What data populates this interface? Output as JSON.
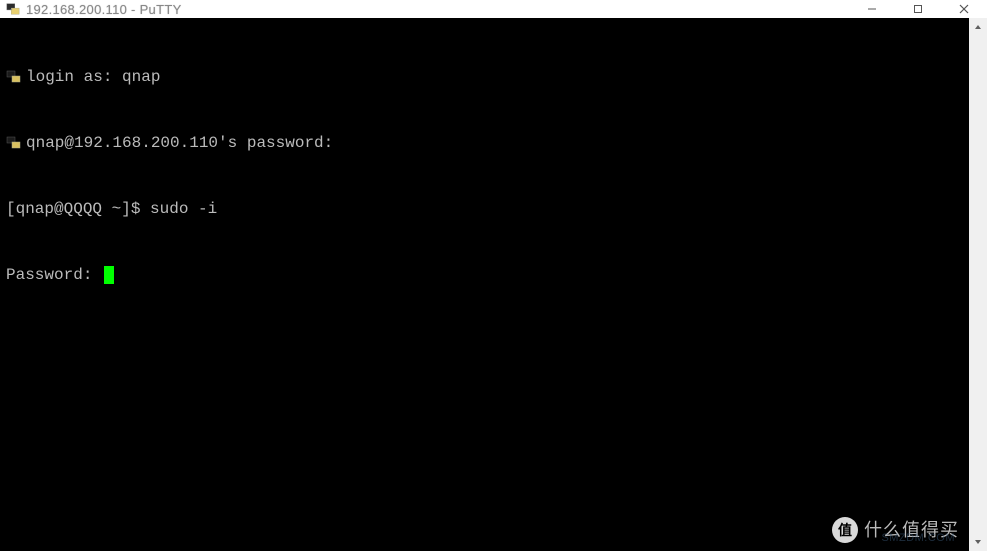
{
  "window": {
    "title": "192.168.200.110 - PuTTY"
  },
  "terminal": {
    "line1_prefix": "login as: ",
    "line1_value": "qnap",
    "line2": "qnap@192.168.200.110's password:",
    "line3_prompt": "[qnap@QQQQ ~]$ ",
    "line3_cmd": "sudo -i",
    "line4": "Password: "
  },
  "watermark": {
    "badge": "值",
    "text": "什么值得买",
    "sub": "SMZDM.COM"
  }
}
